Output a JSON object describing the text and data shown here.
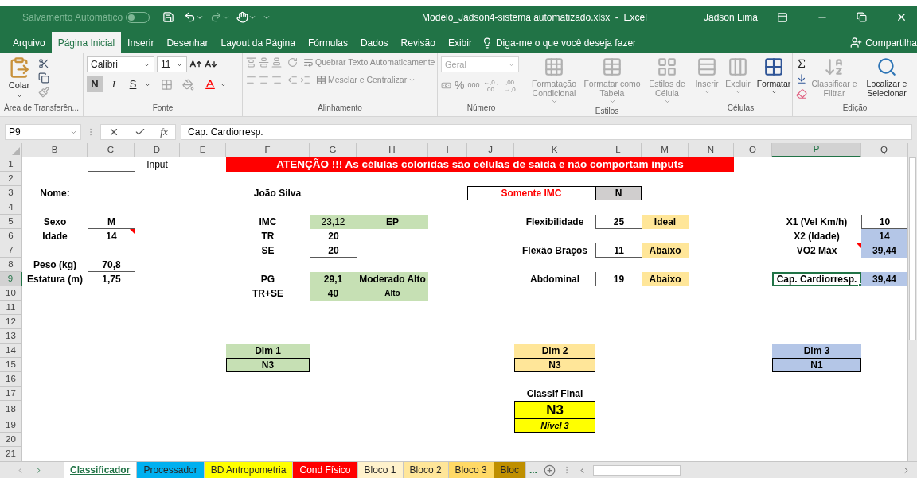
{
  "title_bar": {
    "autosave_label": "Salvamento Automático",
    "autosave_on": false,
    "title": "Modelo_Jadson4-sistema automatizado.xlsx  -  Excel",
    "user": "Jadson Lima"
  },
  "tabs": [
    {
      "label": "Arquivo",
      "selected": false
    },
    {
      "label": "Página Inicial",
      "selected": true
    },
    {
      "label": "Inserir",
      "selected": false
    },
    {
      "label": "Desenhar",
      "selected": false
    },
    {
      "label": "Layout da Página",
      "selected": false
    },
    {
      "label": "Fórmulas",
      "selected": false
    },
    {
      "label": "Dados",
      "selected": false
    },
    {
      "label": "Revisão",
      "selected": false
    },
    {
      "label": "Exibir",
      "selected": false
    }
  ],
  "tell_me": {
    "placeholder": "Diga-me o que você deseja fazer"
  },
  "share": "Compartilha",
  "ribbon": {
    "groups": [
      {
        "kind": "clipboard",
        "label": "Área de Transferên...",
        "buttons": [
          {
            "label": "Colar",
            "disabled": false
          }
        ]
      },
      {
        "kind": "font",
        "label": "Fonte",
        "font": "Calibri",
        "size": "11",
        "styles": [
          {
            "label": "N",
            "selected": true
          },
          {
            "label": "I",
            "selected": false
          },
          {
            "label": "S",
            "selected": false
          }
        ]
      },
      {
        "kind": "alignment",
        "label": "Alinhamento",
        "buttons": [
          {
            "label": "Quebrar Texto Automaticamente",
            "disabled": true
          },
          {
            "label": "Mesclar e Centralizar",
            "disabled": true
          }
        ]
      },
      {
        "kind": "number",
        "label": "Número",
        "format": "Geral",
        "buttons": [
          {
            "label": "%",
            "disabled": true
          },
          {
            "label": "000",
            "disabled": true
          },
          {
            "label": "←,0 ,00",
            "disabled": true
          },
          {
            "label": ",00 →,0",
            "disabled": true
          }
        ]
      },
      {
        "kind": "large",
        "label": "Estilos",
        "buttons": [
          {
            "label": "Formatação Condicional",
            "disabled": true
          },
          {
            "label": "Formatar como Tabela",
            "disabled": true
          },
          {
            "label": "Estilos de Célula",
            "disabled": true
          }
        ]
      },
      {
        "kind": "large",
        "label": "Células",
        "buttons": [
          {
            "label": "Inserir",
            "disabled": true
          },
          {
            "label": "Excluir",
            "disabled": true
          },
          {
            "label": "Formatar",
            "disabled": false
          }
        ]
      },
      {
        "kind": "editing",
        "label": "Edição",
        "buttons": [
          {
            "label": "Classificar e Filtrar",
            "disabled": true
          },
          {
            "label": "Localizar e Selecionar",
            "disabled": false
          }
        ]
      }
    ]
  },
  "formula_bar": {
    "name_box": "P9",
    "fx": "fx",
    "formula": "Cap. Cardiorresp."
  },
  "sheet": {
    "columns": [
      {
        "label": "B",
        "selected": false
      },
      {
        "label": "C",
        "selected": false
      },
      {
        "label": "D",
        "selected": false
      },
      {
        "label": "E",
        "selected": false
      },
      {
        "label": "F",
        "selected": false
      },
      {
        "label": "G",
        "selected": false
      },
      {
        "label": "H",
        "selected": false
      },
      {
        "label": "I",
        "selected": false
      },
      {
        "label": "J",
        "selected": false
      },
      {
        "label": "K",
        "selected": false
      },
      {
        "label": "L",
        "selected": false
      },
      {
        "label": "M",
        "selected": false
      },
      {
        "label": "N",
        "selected": false
      },
      {
        "label": "O",
        "selected": false
      },
      {
        "label": "P",
        "selected": true
      },
      {
        "label": "Q",
        "selected": false
      }
    ],
    "rows": [
      {
        "label": "1",
        "selected": false
      },
      {
        "label": "2",
        "selected": false
      },
      {
        "label": "3",
        "selected": false
      },
      {
        "label": "4",
        "selected": false
      },
      {
        "label": "5",
        "selected": false
      },
      {
        "label": "6",
        "selected": false
      },
      {
        "label": "7",
        "selected": false
      },
      {
        "label": "8",
        "selected": false
      },
      {
        "label": "9",
        "selected": true
      },
      {
        "label": "10",
        "selected": false
      },
      {
        "label": "11",
        "selected": false
      },
      {
        "label": "12",
        "selected": false
      },
      {
        "label": "13",
        "selected": false
      },
      {
        "label": "14",
        "selected": false
      },
      {
        "label": "15",
        "selected": false
      },
      {
        "label": "16",
        "selected": false
      },
      {
        "label": "17",
        "selected": false
      },
      {
        "label": "18",
        "selected": false
      },
      {
        "label": "19",
        "selected": false
      },
      {
        "label": "20",
        "selected": false
      },
      {
        "label": "21",
        "selected": false
      }
    ],
    "cells": [
      {
        "text": "Input",
        "kind": "plain",
        "selected": false,
        "comment": false
      },
      {
        "text": "ATENÇÃO !!! As células coloridas são células de saída e não comportam inputs",
        "kind": "banner",
        "color": "#ff0000",
        "selected": false,
        "comment": false
      },
      {
        "text": "Nome:",
        "kind": "bold",
        "selected": false,
        "comment": false
      },
      {
        "text": "João Silva",
        "kind": "bold",
        "selected": false,
        "comment": false
      },
      {
        "text": "Somente IMC",
        "kind": "warning",
        "selected": false,
        "comment": false
      },
      {
        "text": "N",
        "kind": "bold",
        "color": "#d0cece",
        "selected": false,
        "comment": false
      },
      {
        "text": "Sexo",
        "kind": "bold",
        "selected": false,
        "comment": false
      },
      {
        "text": "M",
        "kind": "bold",
        "selected": false,
        "comment": false
      },
      {
        "text": "IMC",
        "kind": "bold",
        "selected": false,
        "comment": false
      },
      {
        "text": "23,12",
        "kind": "plain",
        "color": "#c6e0b4",
        "selected": false,
        "comment": false
      },
      {
        "text": "EP",
        "kind": "bold",
        "color": "#c6e0b4",
        "selected": false,
        "comment": false
      },
      {
        "text": "Flexibilidade",
        "kind": "bold",
        "selected": false,
        "comment": false
      },
      {
        "text": "25",
        "kind": "bold",
        "selected": false,
        "comment": false
      },
      {
        "text": "Ideal",
        "kind": "bold",
        "color": "#ffe699",
        "selected": false,
        "comment": false
      },
      {
        "text": "X1 (Vel Km/h)",
        "kind": "bold",
        "selected": false,
        "comment": false
      },
      {
        "text": "10",
        "kind": "bold",
        "selected": false,
        "comment": false
      },
      {
        "text": "Idade",
        "kind": "bold",
        "selected": false,
        "comment": false
      },
      {
        "text": "14",
        "kind": "bold",
        "selected": false,
        "comment": true
      },
      {
        "text": "TR",
        "kind": "bold",
        "selected": false,
        "comment": false
      },
      {
        "text": "20",
        "kind": "bold",
        "selected": false,
        "comment": false
      },
      {
        "text": "X2 (Idade)",
        "kind": "bold",
        "selected": false,
        "comment": false
      },
      {
        "text": "14",
        "kind": "bold",
        "color": "#b4c6e7",
        "selected": false,
        "comment": false
      },
      {
        "text": "SE",
        "kind": "bold",
        "selected": false,
        "comment": false
      },
      {
        "text": "20",
        "kind": "bold",
        "selected": false,
        "comment": false
      },
      {
        "text": "Flexão Braços",
        "kind": "bold",
        "selected": false,
        "comment": false
      },
      {
        "text": "11",
        "kind": "bold",
        "selected": false,
        "comment": false
      },
      {
        "text": "Abaixo",
        "kind": "bold",
        "color": "#ffe699",
        "selected": false,
        "comment": false
      },
      {
        "text": "VO2 Máx",
        "kind": "bold",
        "selected": false,
        "comment": true
      },
      {
        "text": "39,44",
        "kind": "bold",
        "color": "#b4c6e7",
        "selected": false,
        "comment": false
      },
      {
        "text": "Peso (kg)",
        "kind": "bold",
        "selected": false,
        "comment": false
      },
      {
        "text": "70,8",
        "kind": "bold",
        "selected": false,
        "comment": false
      },
      {
        "text": "Estatura (m)",
        "kind": "bold",
        "selected": false,
        "comment": false
      },
      {
        "text": "1,75",
        "kind": "bold",
        "selected": false,
        "comment": false
      },
      {
        "text": "PG",
        "kind": "bold",
        "selected": false,
        "comment": false
      },
      {
        "text": "29,1",
        "kind": "bold",
        "color": "#c6e0b4",
        "selected": false,
        "comment": false
      },
      {
        "text": "Moderado Alto",
        "kind": "bold",
        "color": "#c6e0b4",
        "selected": false,
        "comment": false
      },
      {
        "text": "Abdominal",
        "kind": "bold",
        "selected": false,
        "comment": false
      },
      {
        "text": "19",
        "kind": "bold",
        "selected": false,
        "comment": false
      },
      {
        "text": "Abaixo",
        "kind": "bold",
        "color": "#ffe699",
        "selected": false,
        "comment": false
      },
      {
        "text": "Cap. Cardiorresp.",
        "kind": "bold",
        "selected": true,
        "comment": false
      },
      {
        "text": "39,44",
        "kind": "bold",
        "color": "#b4c6e7",
        "selected": false,
        "comment": false
      },
      {
        "text": "TR+SE",
        "kind": "bold",
        "selected": false,
        "comment": false
      },
      {
        "text": "40",
        "kind": "bold",
        "color": "#c6e0b4",
        "selected": false,
        "comment": false
      },
      {
        "text": "Alto",
        "kind": "small",
        "color": "#c6e0b4",
        "selected": false,
        "comment": false
      },
      {
        "text": "Dim 1",
        "kind": "bold",
        "color": "#c6e0b4",
        "selected": false,
        "comment": false
      },
      {
        "text": "Dim 2",
        "kind": "bold",
        "color": "#ffe699",
        "selected": false,
        "comment": false
      },
      {
        "text": "Dim 3",
        "kind": "bold",
        "color": "#b4c6e7",
        "selected": false,
        "comment": false
      },
      {
        "text": "N3",
        "kind": "bold",
        "color": "#c6e0b4",
        "selected": false,
        "comment": false
      },
      {
        "text": "N3",
        "kind": "bold",
        "color": "#ffe699",
        "selected": false,
        "comment": false
      },
      {
        "text": "N1",
        "kind": "bold",
        "color": "#b4c6e7",
        "selected": false,
        "comment": false
      },
      {
        "text": "Classif Final",
        "kind": "bold",
        "selected": false,
        "comment": false
      },
      {
        "text": "N3",
        "kind": "big",
        "color": "#ffff00",
        "selected": false,
        "comment": false
      },
      {
        "text": "Nível 3",
        "kind": "note",
        "color": "#ffff00",
        "selected": false,
        "comment": false
      }
    ]
  },
  "sheet_tabs": {
    "tabs": [
      {
        "label": "Classificador",
        "selected": true,
        "color": "#ffffff"
      },
      {
        "label": "Processador",
        "selected": false,
        "color": "#00b0f0"
      },
      {
        "label": "BD Antropometria",
        "selected": false,
        "color": "#ffff00"
      },
      {
        "label": "Cond Físico",
        "selected": false,
        "color": "#ff0000"
      },
      {
        "label": "Bloco 1",
        "selected": false,
        "color": "#fff2cc"
      },
      {
        "label": "Bloco 2",
        "selected": false,
        "color": "#ffe699"
      },
      {
        "label": "Bloco 3",
        "selected": false,
        "color": "#ffd966"
      },
      {
        "label": "Bloc",
        "selected": false,
        "color": "#bf8f00"
      }
    ],
    "more": "..."
  }
}
